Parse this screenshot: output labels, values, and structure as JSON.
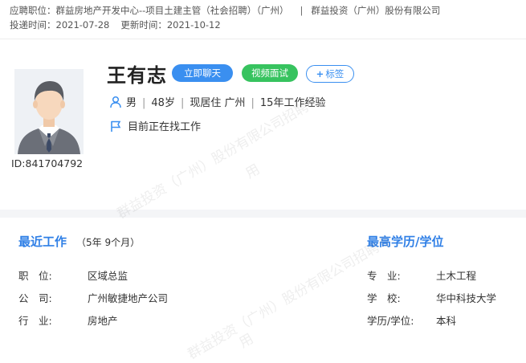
{
  "header": {
    "position_label": "应聘职位：",
    "position_value": "群益房地产开发中心--项目土建主管（社会招聘）（广州）",
    "separator": "|",
    "company_value": "群益投资（广州）股份有限公司",
    "submit_label": "投递时间：",
    "submit_value": "2021-07-28",
    "update_label": "更新时间：",
    "update_value": "2021-10-12"
  },
  "profile": {
    "id_text": "ID:841704792",
    "name": "王有志",
    "chat_button": "立即聊天",
    "video_button": "视频面试",
    "tag_plus": "+",
    "tag_button": "标签",
    "gender": "男",
    "age": "48岁",
    "residence_label": "现居住",
    "residence": "广州",
    "experience": "15年工作经验",
    "divider": "|",
    "status": "目前正在找工作"
  },
  "recent_work": {
    "title": "最近工作",
    "duration": "（5年 9个月）",
    "rows": [
      {
        "label": "职　位:",
        "value": "区域总监"
      },
      {
        "label": "公　司:",
        "value": "广州敏捷地产公司"
      },
      {
        "label": "行　业:",
        "value": "房地产"
      }
    ]
  },
  "education": {
    "title": "最高学历/学位",
    "rows": [
      {
        "label": "专　业:",
        "value": "土木工程"
      },
      {
        "label": "学　校:",
        "value": "华中科技大学"
      },
      {
        "label": "学历/学位:",
        "value": "本科"
      }
    ]
  },
  "watermarks": {
    "line1": "群益投资（广州）股份有限公司招聘专",
    "line1_tail": "用",
    "line2": "群益投资（广州）股份有限公司招聘专",
    "line2_tail": "用"
  },
  "colors": {
    "accent": "#2f7fe6",
    "chat_button": "#3a8ff0",
    "video_button": "#37c35f"
  },
  "icons": [
    "person-icon",
    "flag-icon"
  ]
}
